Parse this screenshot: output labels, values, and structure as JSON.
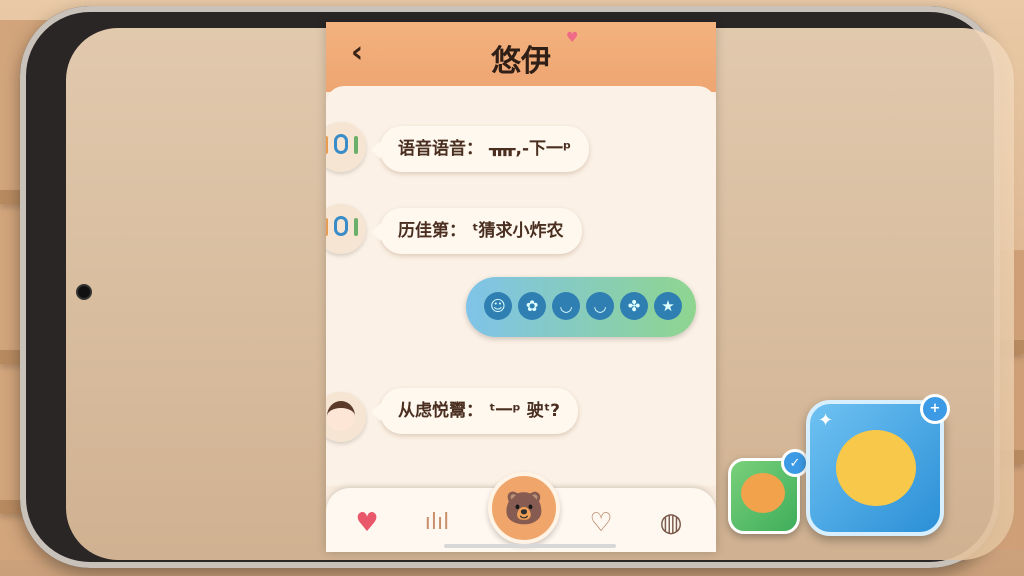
{
  "chat": {
    "title": "悠伊",
    "back_icon": "‹",
    "messages": [
      {
        "type": "voice",
        "text": "语音语音：  ᚄ,-下一ᵖ"
      },
      {
        "type": "voice",
        "text": "历佳第：  ᵗ猜求小炸农"
      },
      {
        "type": "emoji",
        "emojis": [
          "☺",
          "✿",
          "◡",
          "◡",
          "✤",
          "★"
        ]
      },
      {
        "type": "user",
        "text": "从虑悦鬻：  ᵗ一ᵖ 驶ᵗ?"
      }
    ]
  },
  "bottom_bar": {
    "items": [
      "heart-icon",
      "voice-wave-icon",
      "bear-home-icon",
      "heart-outline-icon",
      "globe-icon"
    ]
  },
  "colors": {
    "header": "#eea572",
    "accent": "#f0a56b",
    "emoji_bubble_start": "#7fc3e9",
    "emoji_bubble_end": "#8fd58f"
  }
}
